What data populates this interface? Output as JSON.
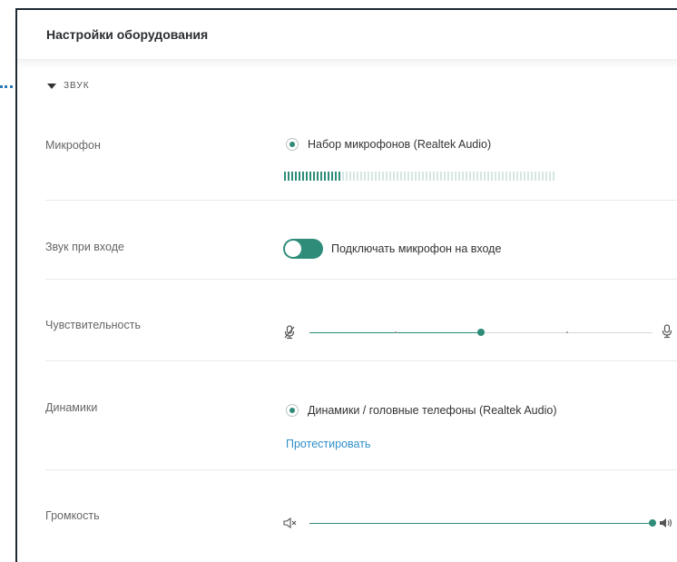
{
  "header": {
    "title": "Настройки оборудования"
  },
  "section": {
    "label": "ЗВУК",
    "expanded": true
  },
  "microphone": {
    "label": "Микрофон",
    "device": "Набор микрофонов (Realtek Audio)",
    "level_active_segments": 16,
    "level_total_segments": 75
  },
  "join_sound": {
    "label": "Звук при входе",
    "toggle_on": true,
    "toggle_label": "Подключать микрофон на входе"
  },
  "sensitivity": {
    "label": "Чувствительность",
    "level": 0.5,
    "icon_min": "mic-muted-icon",
    "icon_max": "mic-icon"
  },
  "speakers": {
    "label": "Динамики",
    "device": "Динамики / головные телефоны (Realtek Audio)",
    "test_link": "Протестировать"
  },
  "volume": {
    "label": "Громкость",
    "level": 1.0,
    "icon_min": "speaker-muted-icon",
    "icon_max": "speaker-loud-icon"
  },
  "colors": {
    "accent": "#2e8c79",
    "link": "#2f8fc9",
    "guide": "#2a7ab8"
  }
}
